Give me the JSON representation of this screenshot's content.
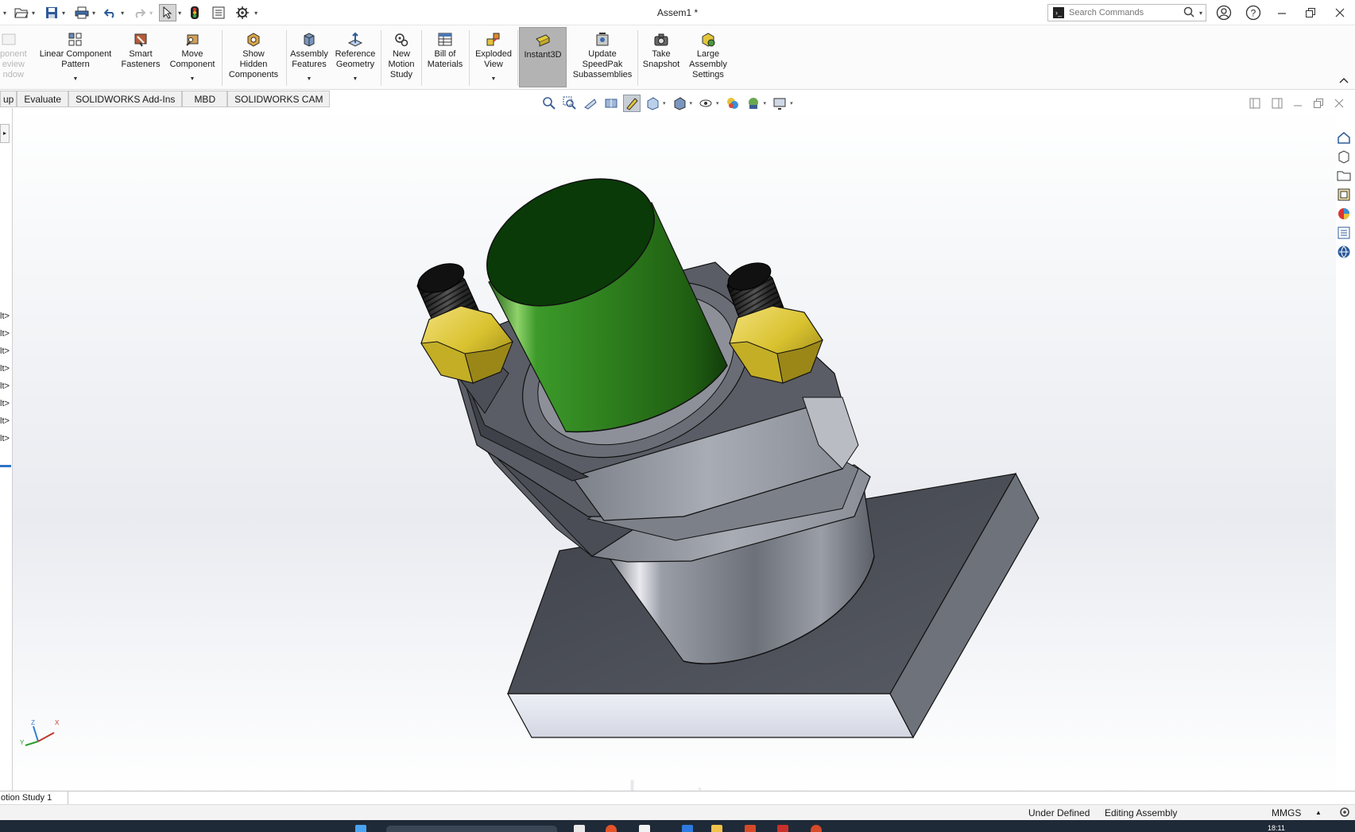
{
  "window": {
    "title": "Assem1 *"
  },
  "search": {
    "placeholder": "Search Commands"
  },
  "ribbon": {
    "buttons": [
      {
        "label": "ponent\neview\nndow"
      },
      {
        "label": "Linear Component\nPattern"
      },
      {
        "label": "Smart\nFasteners"
      },
      {
        "label": "Move\nComponent"
      },
      {
        "label": "Show\nHidden\nComponents"
      },
      {
        "label": "Assembly\nFeatures"
      },
      {
        "label": "Reference\nGeometry"
      },
      {
        "label": "New\nMotion\nStudy"
      },
      {
        "label": "Bill of\nMaterials"
      },
      {
        "label": "Exploded\nView"
      },
      {
        "label": "Instant3D"
      },
      {
        "label": "Update\nSpeedPak\nSubassemblies"
      },
      {
        "label": "Take\nSnapshot"
      },
      {
        "label": "Large\nAssembly\nSettings"
      }
    ]
  },
  "tabs": [
    {
      "label": "up"
    },
    {
      "label": "Evaluate"
    },
    {
      "label": "SOLIDWORKS Add-Ins"
    },
    {
      "label": "MBD"
    },
    {
      "label": "SOLIDWORKS CAM"
    }
  ],
  "tree": {
    "items": [
      "lt>",
      "lt>",
      "lt>",
      "lt>",
      "lt>",
      "lt>",
      "lt>",
      "lt>"
    ]
  },
  "triad": {
    "z": "Z",
    "x": "X",
    "y": "Y"
  },
  "motion": {
    "tab_label": "otion Study 1"
  },
  "status": {
    "definition": "Under Defined",
    "mode": "Editing Assembly",
    "units": "MMGS"
  },
  "taskbar": {
    "clock": "18:11"
  },
  "watermark": {
    "text": "خمسات"
  },
  "colors": {
    "cylinder_green": "#2e7d1f",
    "nut_yellow": "#d9c431",
    "plate_dark": "#4a4d55",
    "metal_grey": "#8c9098",
    "instant3d_active": "#b3b3b3"
  }
}
